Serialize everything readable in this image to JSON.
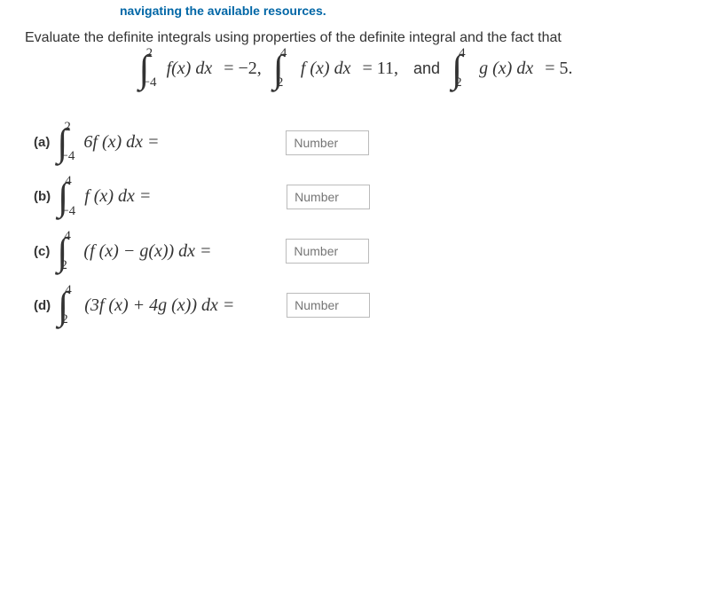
{
  "nav": {
    "text": "navigating the available resources."
  },
  "intro": "Evaluate the definite integrals using properties of the definite integral and the fact that",
  "facts": {
    "i1": {
      "upper": "2",
      "lower": "−4",
      "integrand": "f(x) dx",
      "eq": "= −2,"
    },
    "i2": {
      "upper": "4",
      "lower": "2",
      "integrand": "f (x) dx",
      "eq": "= 11,"
    },
    "and": "and",
    "i3": {
      "upper": "4",
      "lower": "2",
      "integrand": "g (x) dx",
      "eq": "= 5."
    }
  },
  "problems": {
    "a": {
      "label": "(a)",
      "upper": "2",
      "lower": "−4",
      "integrand": "6f (x) dx =",
      "placeholder": "Number"
    },
    "b": {
      "label": "(b)",
      "upper": "4",
      "lower": "−4",
      "integrand": "f (x) dx =",
      "placeholder": "Number"
    },
    "c": {
      "label": "(c)",
      "upper": "4",
      "lower": "2",
      "integrand": "(f (x) − g(x)) dx =",
      "placeholder": "Number"
    },
    "d": {
      "label": "(d)",
      "upper": "4",
      "lower": "2",
      "integrand": "(3f (x) + 4g (x)) dx =",
      "placeholder": "Number"
    }
  }
}
